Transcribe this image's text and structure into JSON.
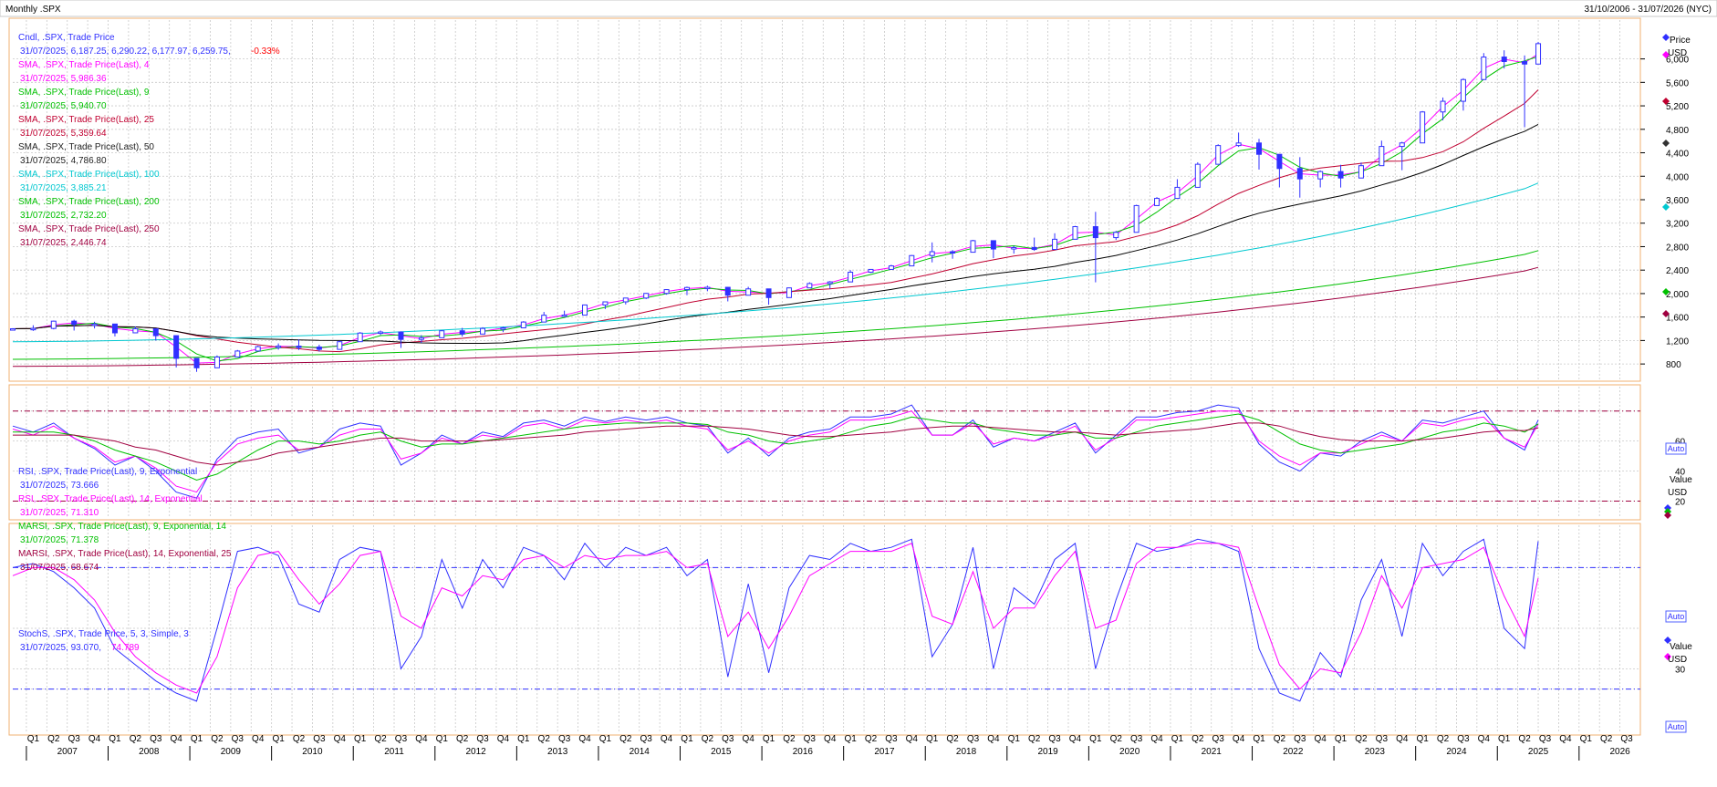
{
  "header": {
    "left_title": "Monthly .SPX",
    "right_range": "31/10/2006 - 31/07/2026 (NYC)"
  },
  "colors": {
    "candle": "#3030ff",
    "sma4": "#ff00ff",
    "sma9": "#00c000",
    "sma25": "#c00030",
    "sma50": "#000000",
    "sma100": "#00c8d0",
    "sma200": "#00c000",
    "sma250": "#a00040",
    "rsi9": "#3030ff",
    "rsi14": "#ff00ff",
    "marsi9": "#00c000",
    "marsi14": "#a00040",
    "stoch_k": "#3030ff",
    "stoch_d": "#ff00ff",
    "negative": "#ff0000",
    "ref_line_red": "#a00040",
    "ref_line_blue": "#3030ff"
  },
  "legend": {
    "price": [
      {
        "label": "Cndl, .SPX, Trade Price",
        "value": "31/07/2025, 6,187.25, 6,290.22, 6,177.97, 6,259.75,",
        "change": "-0.33%",
        "color": "#3030ff"
      },
      {
        "label": "SMA, .SPX, Trade Price(Last), 4",
        "value": "31/07/2025, 5,986.36",
        "color": "#ff00ff"
      },
      {
        "label": "SMA, .SPX, Trade Price(Last), 9",
        "value": "31/07/2025, 5,940.70",
        "color": "#00c000"
      },
      {
        "label": "SMA, .SPX, Trade Price(Last), 25",
        "value": "31/07/2025, 5,359.64",
        "color": "#c00030"
      },
      {
        "label": "SMA, .SPX, Trade Price(Last), 50",
        "value": "31/07/2025, 4,786.80",
        "color": "#222222"
      },
      {
        "label": "SMA, .SPX, Trade Price(Last), 100",
        "value": "31/07/2025, 3,885.21",
        "color": "#00c8d0"
      },
      {
        "label": "SMA, .SPX, Trade Price(Last), 200",
        "value": "31/07/2025, 2,732.20",
        "color": "#00c000"
      },
      {
        "label": "SMA, .SPX, Trade Price(Last), 250",
        "value": "31/07/2025, 2,446.74",
        "color": "#a00040"
      }
    ],
    "rsi": [
      {
        "label": "RSI, .SPX, Trade Price(Last), 9, Exponential",
        "value": "31/07/2025, 73.666",
        "color": "#3030ff"
      },
      {
        "label": "RSI, .SPX, Trade Price(Last), 14, Exponential",
        "value": "31/07/2025, 71.310",
        "color": "#ff00ff"
      },
      {
        "label": "MARSI, .SPX, Trade Price(Last), 9, Exponential, 14",
        "value": "31/07/2025, 71.378",
        "color": "#00c000"
      },
      {
        "label": "MARSI, .SPX, Trade Price(Last), 14, Exponential, 25",
        "value": "31/07/2025, 68.674",
        "color": "#a00040"
      }
    ],
    "stoch": [
      {
        "label": "StochS, .SPX, Trade Price, 5, 3, Simple, 3",
        "value": "31/07/2025, 93.070,",
        "value2": "74.789",
        "color": "#3030ff",
        "color2": "#ff00ff"
      }
    ]
  },
  "right_axis": {
    "price_title": "Price",
    "price_unit": "USD",
    "indicator_title": "Value",
    "indicator_unit": "USD",
    "auto_label": "Auto"
  },
  "chart_data": [
    {
      "type": "candlestick",
      "name": "price",
      "title": "",
      "x": [
        "2006-11",
        "2007-02",
        "2007-05",
        "2007-08",
        "2007-11",
        "2008-02",
        "2008-05",
        "2008-08",
        "2008-11",
        "2009-02",
        "2009-05",
        "2009-08",
        "2009-11",
        "2010-02",
        "2010-05",
        "2010-08",
        "2010-11",
        "2011-02",
        "2011-05",
        "2011-08",
        "2011-11",
        "2012-02",
        "2012-05",
        "2012-08",
        "2012-11",
        "2013-02",
        "2013-05",
        "2013-08",
        "2013-11",
        "2014-02",
        "2014-05",
        "2014-08",
        "2014-11",
        "2015-02",
        "2015-05",
        "2015-08",
        "2015-11",
        "2016-02",
        "2016-05",
        "2016-08",
        "2016-11",
        "2017-02",
        "2017-05",
        "2017-08",
        "2017-11",
        "2018-02",
        "2018-05",
        "2018-08",
        "2018-11",
        "2019-02",
        "2019-05",
        "2019-08",
        "2019-11",
        "2020-02",
        "2020-05",
        "2020-08",
        "2020-11",
        "2021-02",
        "2021-05",
        "2021-08",
        "2021-11",
        "2022-02",
        "2022-05",
        "2022-08",
        "2022-11",
        "2023-02",
        "2023-05",
        "2023-08",
        "2023-11",
        "2024-02",
        "2024-05",
        "2024-08",
        "2024-11",
        "2025-02",
        "2025-05",
        "2025-07"
      ],
      "close": [
        1400,
        1406,
        1530,
        1474,
        1481,
        1331,
        1400,
        1283,
        896,
        735,
        919,
        1021,
        1096,
        1104,
        1089,
        1049,
        1180,
        1327,
        1345,
        1219,
        1247,
        1366,
        1310,
        1406,
        1416,
        1515,
        1631,
        1633,
        1806,
        1859,
        1924,
        2003,
        2068,
        2104,
        2107,
        1972,
        2080,
        1932,
        2097,
        2171,
        2199,
        2364,
        2412,
        2472,
        2648,
        2714,
        2705,
        2902,
        2760,
        2784,
        2752,
        2926,
        3141,
        2954,
        3044,
        3500,
        3622,
        3811,
        4204,
        4523,
        4567,
        4374,
        4132,
        3955,
        4080,
        3970,
        4180,
        4508,
        4568,
        5096,
        5278,
        5648,
        6032,
        5955,
        5912,
        6260
      ],
      "high": [
        1410,
        1460,
        1540,
        1555,
        1520,
        1410,
        1440,
        1313,
        1007,
        876,
        946,
        1039,
        1113,
        1150,
        1219,
        1129,
        1198,
        1344,
        1370,
        1356,
        1292,
        1378,
        1415,
        1426,
        1437,
        1530,
        1687,
        1709,
        1813,
        1867,
        1928,
        2011,
        2075,
        2119,
        2135,
        2113,
        2116,
        2081,
        2104,
        2193,
        2214,
        2400,
        2418,
        2490,
        2657,
        2872,
        2742,
        2916,
        2815,
        2813,
        2954,
        3028,
        3154,
        3393,
        3068,
        3514,
        3645,
        3950,
        4238,
        4545,
        4744,
        4637,
        4303,
        4325,
        4100,
        4195,
        4234,
        4607,
        4587,
        5111,
        5342,
        5670,
        6099,
        6147,
        6059,
        6290
      ],
      "low": [
        1385,
        1364,
        1390,
        1370,
        1406,
        1270,
        1325,
        1200,
        741,
        666,
        875,
        979,
        1029,
        1044,
        1040,
        1011,
        1160,
        1294,
        1294,
        1074,
        1159,
        1300,
        1267,
        1359,
        1343,
        1486,
        1560,
        1600,
        1746,
        1737,
        1814,
        1905,
        1981,
        1973,
        2040,
        1867,
        2017,
        1810,
        2025,
        2147,
        2083,
        2322,
        2352,
        2417,
        2557,
        2532,
        2594,
        2866,
        2603,
        2681,
        2728,
        2822,
        3070,
        2192,
        2914,
        3209,
        3579,
        3694,
        4056,
        4367,
        4500,
        4114,
        3810,
        3636,
        3810,
        3808,
        4048,
        4336,
        4103,
        4845,
        4953,
        5119,
        5832,
        5837,
        4835,
        6178
      ],
      "sma": {
        "4": 5986.36,
        "9": 5940.7,
        "25": 5359.64,
        "50": 4786.8,
        "100": 3885.21,
        "200": 2732.2,
        "250": 2446.74
      },
      "ylim": [
        600,
        6600
      ],
      "yticks": [
        "800",
        "1,200",
        "1,600",
        "2,000",
        "2,400",
        "2,800",
        "3,200",
        "3,600",
        "4,000",
        "4,400",
        "4,800",
        "5,200",
        "5,600",
        "6,000"
      ],
      "grid": true
    },
    {
      "type": "line",
      "name": "rsi",
      "title": "",
      "x": [
        "2006-11",
        "2007-02",
        "2007-05",
        "2007-08",
        "2007-11",
        "2008-02",
        "2008-05",
        "2008-08",
        "2008-11",
        "2009-02",
        "2009-05",
        "2009-08",
        "2009-11",
        "2010-02",
        "2010-05",
        "2010-08",
        "2010-11",
        "2011-02",
        "2011-05",
        "2011-08",
        "2011-11",
        "2012-02",
        "2012-05",
        "2012-08",
        "2012-11",
        "2013-02",
        "2013-05",
        "2013-08",
        "2013-11",
        "2014-02",
        "2014-05",
        "2014-08",
        "2014-11",
        "2015-02",
        "2015-05",
        "2015-08",
        "2015-11",
        "2016-02",
        "2016-05",
        "2016-08",
        "2016-11",
        "2017-02",
        "2017-05",
        "2017-08",
        "2017-11",
        "2018-02",
        "2018-05",
        "2018-08",
        "2018-11",
        "2019-02",
        "2019-05",
        "2019-08",
        "2019-11",
        "2020-02",
        "2020-05",
        "2020-08",
        "2020-11",
        "2021-02",
        "2021-05",
        "2021-08",
        "2021-11",
        "2022-02",
        "2022-05",
        "2022-08",
        "2022-11",
        "2023-02",
        "2023-05",
        "2023-08",
        "2023-11",
        "2024-02",
        "2024-05",
        "2024-08",
        "2024-11",
        "2025-02",
        "2025-05",
        "2025-07"
      ],
      "series": [
        {
          "name": "RSI 9",
          "values": [
            70,
            66,
            72,
            62,
            55,
            44,
            50,
            40,
            26,
            22,
            48,
            62,
            66,
            68,
            52,
            56,
            68,
            72,
            70,
            44,
            52,
            64,
            58,
            66,
            63,
            72,
            74,
            70,
            76,
            73,
            76,
            74,
            76,
            72,
            70,
            52,
            62,
            50,
            62,
            66,
            68,
            76,
            76,
            78,
            84,
            64,
            64,
            74,
            56,
            62,
            60,
            66,
            72,
            52,
            64,
            76,
            76,
            79,
            80,
            84,
            82,
            58,
            46,
            40,
            52,
            50,
            60,
            66,
            60,
            74,
            72,
            76,
            80,
            62,
            54,
            74
          ]
        },
        {
          "name": "RSI 14",
          "values": [
            68,
            64,
            70,
            62,
            56,
            46,
            50,
            42,
            30,
            26,
            46,
            58,
            62,
            64,
            54,
            56,
            64,
            68,
            68,
            48,
            52,
            62,
            58,
            64,
            62,
            70,
            72,
            68,
            74,
            72,
            74,
            72,
            74,
            70,
            68,
            54,
            60,
            52,
            60,
            64,
            66,
            74,
            74,
            76,
            80,
            64,
            64,
            72,
            58,
            62,
            60,
            64,
            70,
            54,
            62,
            74,
            74,
            76,
            78,
            80,
            80,
            60,
            50,
            44,
            52,
            52,
            58,
            64,
            60,
            72,
            70,
            74,
            76,
            62,
            56,
            71
          ]
        },
        {
          "name": "MARSI 9",
          "values": [
            66,
            66,
            66,
            64,
            60,
            54,
            50,
            46,
            40,
            34,
            38,
            46,
            54,
            60,
            60,
            58,
            60,
            64,
            66,
            60,
            56,
            58,
            58,
            60,
            62,
            64,
            66,
            68,
            70,
            71,
            72,
            72,
            72,
            72,
            71,
            66,
            64,
            60,
            58,
            60,
            62,
            66,
            70,
            72,
            76,
            74,
            72,
            72,
            68,
            66,
            64,
            64,
            66,
            62,
            62,
            66,
            70,
            72,
            74,
            76,
            78,
            74,
            66,
            58,
            54,
            52,
            54,
            56,
            58,
            62,
            66,
            68,
            72,
            70,
            66,
            71.4
          ]
        },
        {
          "name": "MARSI 14",
          "values": [
            64,
            64,
            64,
            64,
            62,
            60,
            56,
            54,
            50,
            46,
            44,
            46,
            48,
            52,
            54,
            56,
            58,
            60,
            62,
            62,
            60,
            60,
            60,
            60,
            61,
            62,
            63,
            64,
            66,
            67,
            68,
            69,
            70,
            70,
            70,
            69,
            68,
            66,
            64,
            63,
            63,
            64,
            65,
            66,
            68,
            69,
            70,
            70,
            69,
            68,
            67,
            66,
            66,
            65,
            64,
            65,
            66,
            67,
            68,
            70,
            72,
            72,
            70,
            66,
            63,
            61,
            60,
            60,
            60,
            61,
            62,
            64,
            66,
            67,
            67,
            68.7
          ]
        }
      ],
      "ylim": [
        10,
        95
      ],
      "yticks": [
        "20",
        "40",
        "60"
      ],
      "reference_lines": [
        20,
        80
      ],
      "grid": true
    },
    {
      "type": "line",
      "name": "stochastic",
      "title": "",
      "x": [
        "2006-11",
        "2007-02",
        "2007-05",
        "2007-08",
        "2007-11",
        "2008-02",
        "2008-05",
        "2008-08",
        "2008-11",
        "2009-02",
        "2009-05",
        "2009-08",
        "2009-11",
        "2010-02",
        "2010-05",
        "2010-08",
        "2010-11",
        "2011-02",
        "2011-05",
        "2011-08",
        "2011-11",
        "2012-02",
        "2012-05",
        "2012-08",
        "2012-11",
        "2013-02",
        "2013-05",
        "2013-08",
        "2013-11",
        "2014-02",
        "2014-05",
        "2014-08",
        "2014-11",
        "2015-02",
        "2015-05",
        "2015-08",
        "2015-11",
        "2016-02",
        "2016-05",
        "2016-08",
        "2016-11",
        "2017-02",
        "2017-05",
        "2017-08",
        "2017-11",
        "2018-02",
        "2018-05",
        "2018-08",
        "2018-11",
        "2019-02",
        "2019-05",
        "2019-08",
        "2019-11",
        "2020-02",
        "2020-05",
        "2020-08",
        "2020-11",
        "2021-02",
        "2021-05",
        "2021-08",
        "2021-11",
        "2022-02",
        "2022-05",
        "2022-08",
        "2022-11",
        "2023-02",
        "2023-05",
        "2023-08",
        "2023-11",
        "2024-02",
        "2024-05",
        "2024-08",
        "2024-11",
        "2025-02",
        "2025-05",
        "2025-07"
      ],
      "series": [
        {
          "name": "%K",
          "values": [
            80,
            82,
            78,
            70,
            60,
            40,
            32,
            24,
            18,
            14,
            50,
            88,
            90,
            86,
            62,
            58,
            84,
            90,
            88,
            30,
            46,
            84,
            60,
            84,
            70,
            90,
            86,
            74,
            92,
            80,
            90,
            86,
            90,
            76,
            84,
            26,
            72,
            28,
            70,
            86,
            84,
            92,
            88,
            90,
            94,
            36,
            52,
            90,
            30,
            70,
            62,
            84,
            92,
            30,
            64,
            92,
            88,
            90,
            94,
            92,
            88,
            40,
            18,
            14,
            38,
            26,
            64,
            84,
            46,
            92,
            76,
            88,
            94,
            50,
            40,
            93
          ]
        },
        {
          "name": "%D",
          "values": [
            76,
            80,
            80,
            74,
            64,
            48,
            36,
            28,
            22,
            18,
            36,
            70,
            86,
            88,
            74,
            62,
            72,
            86,
            88,
            56,
            50,
            70,
            66,
            76,
            74,
            84,
            86,
            80,
            86,
            84,
            86,
            86,
            88,
            80,
            82,
            46,
            58,
            40,
            56,
            76,
            82,
            88,
            88,
            88,
            92,
            56,
            52,
            78,
            50,
            60,
            60,
            76,
            88,
            50,
            54,
            82,
            90,
            90,
            92,
            92,
            90,
            60,
            32,
            20,
            30,
            28,
            48,
            76,
            60,
            80,
            82,
            84,
            90,
            66,
            46,
            74.8
          ]
        }
      ],
      "ylim": [
        0,
        100
      ],
      "yticks": [
        "30"
      ],
      "reference_lines": [
        20,
        80
      ],
      "grid": true
    }
  ],
  "x_axis": {
    "quarter_labels": [
      "Q1",
      "Q2",
      "Q3",
      "Q4"
    ],
    "years": [
      "2007",
      "2008",
      "2009",
      "2010",
      "2011",
      "2012",
      "2013",
      "2014",
      "2015",
      "2016",
      "2017",
      "2018",
      "2019",
      "2020",
      "2021",
      "2022",
      "2023",
      "2024",
      "2025",
      "2026"
    ],
    "last_year_quarters": [
      "Q1",
      "Q2",
      "Q3"
    ]
  }
}
